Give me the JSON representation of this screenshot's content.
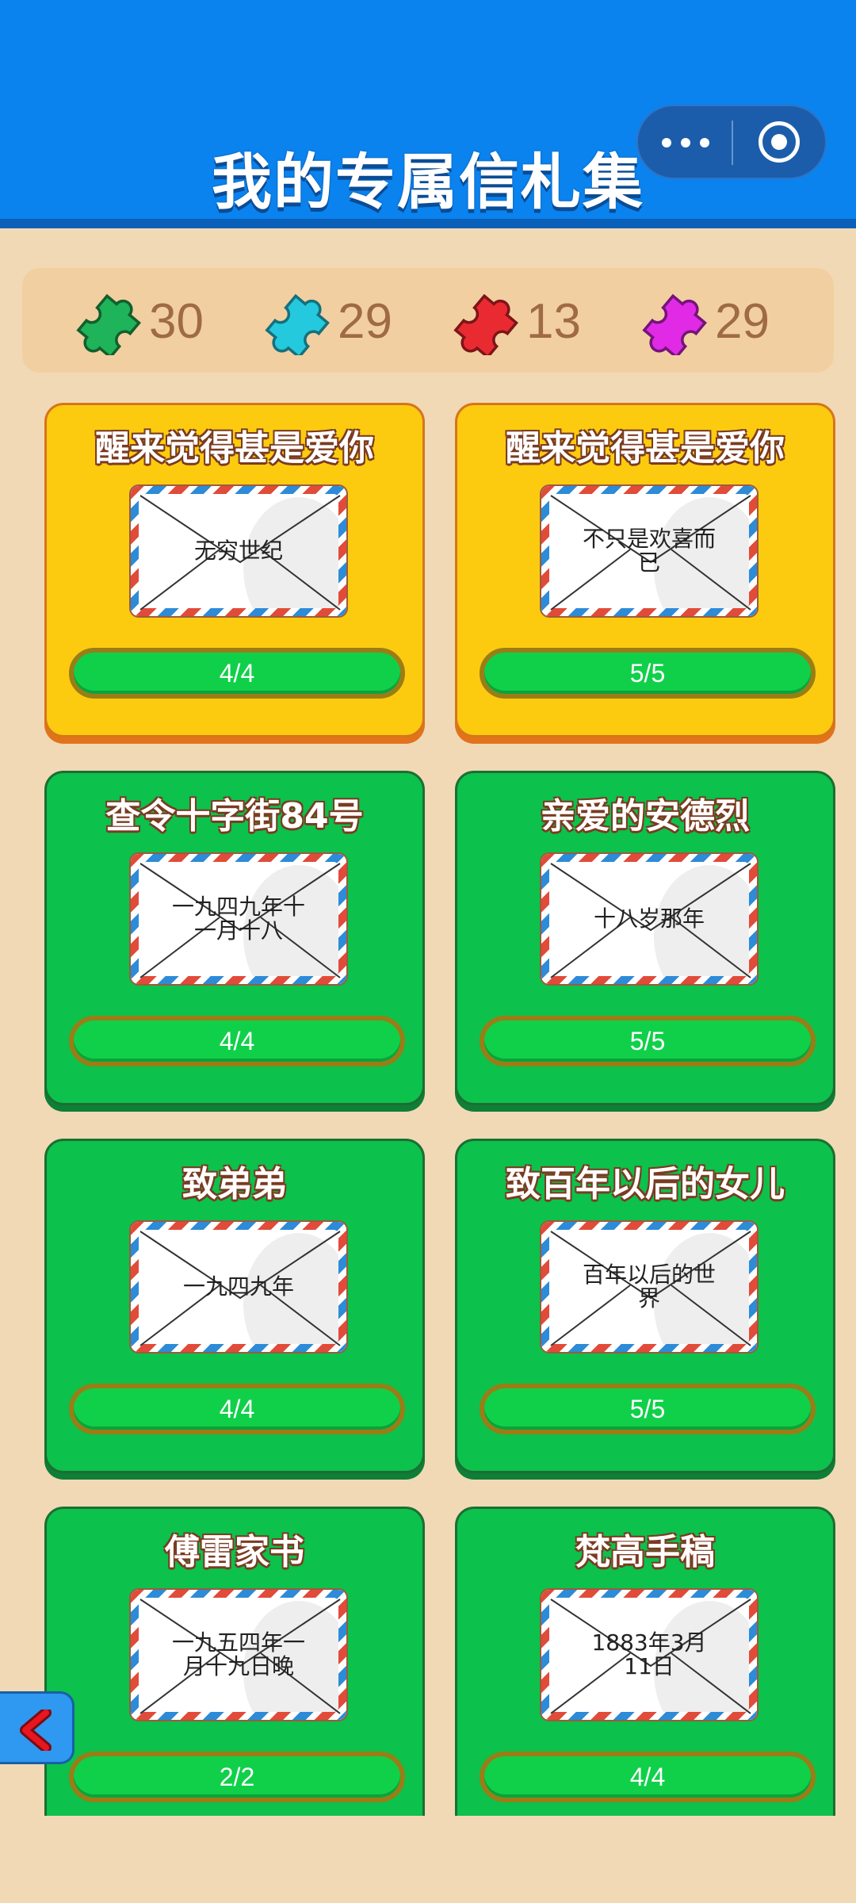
{
  "header": {
    "title": "我的专属信札集",
    "more_icon": "more-dots-icon",
    "close_icon": "target-circle-icon"
  },
  "stats": [
    {
      "icon": "puzzle-piece-icon",
      "color": "#1fb35a",
      "count": "30"
    },
    {
      "icon": "puzzle-piece-icon",
      "color": "#25c9dd",
      "count": "29"
    },
    {
      "icon": "puzzle-piece-icon",
      "color": "#ea2a31",
      "count": "13"
    },
    {
      "icon": "puzzle-piece-icon",
      "color": "#e02ae6",
      "count": "29"
    }
  ],
  "cards": [
    {
      "title": "醒来觉得甚是爱你",
      "envelope_text": "无穷世纪",
      "progress": "4/4",
      "style": "gold"
    },
    {
      "title": "醒来觉得甚是爱你",
      "envelope_text": "不只是欢喜而已",
      "progress": "5/5",
      "style": "gold"
    },
    {
      "title": "查令十字街84号",
      "envelope_text": "一九四九年十一月十八",
      "progress": "4/4",
      "style": "green"
    },
    {
      "title": "亲爱的安德烈",
      "envelope_text": "十八岁那年",
      "progress": "5/5",
      "style": "green"
    },
    {
      "title": "致弟弟",
      "envelope_text": "一九四九年",
      "progress": "4/4",
      "style": "green"
    },
    {
      "title": "致百年以后的女儿",
      "envelope_text": "百年以后的世界",
      "progress": "5/5",
      "style": "green"
    },
    {
      "title": "傅雷家书",
      "envelope_text": "一九五四年一月十九日晚",
      "progress": "2/2",
      "style": "green"
    },
    {
      "title": "梵高手稿",
      "envelope_text": "1883年3月11日",
      "progress": "4/4",
      "style": "green"
    }
  ],
  "back_button": {
    "icon": "chevron-left-icon"
  }
}
